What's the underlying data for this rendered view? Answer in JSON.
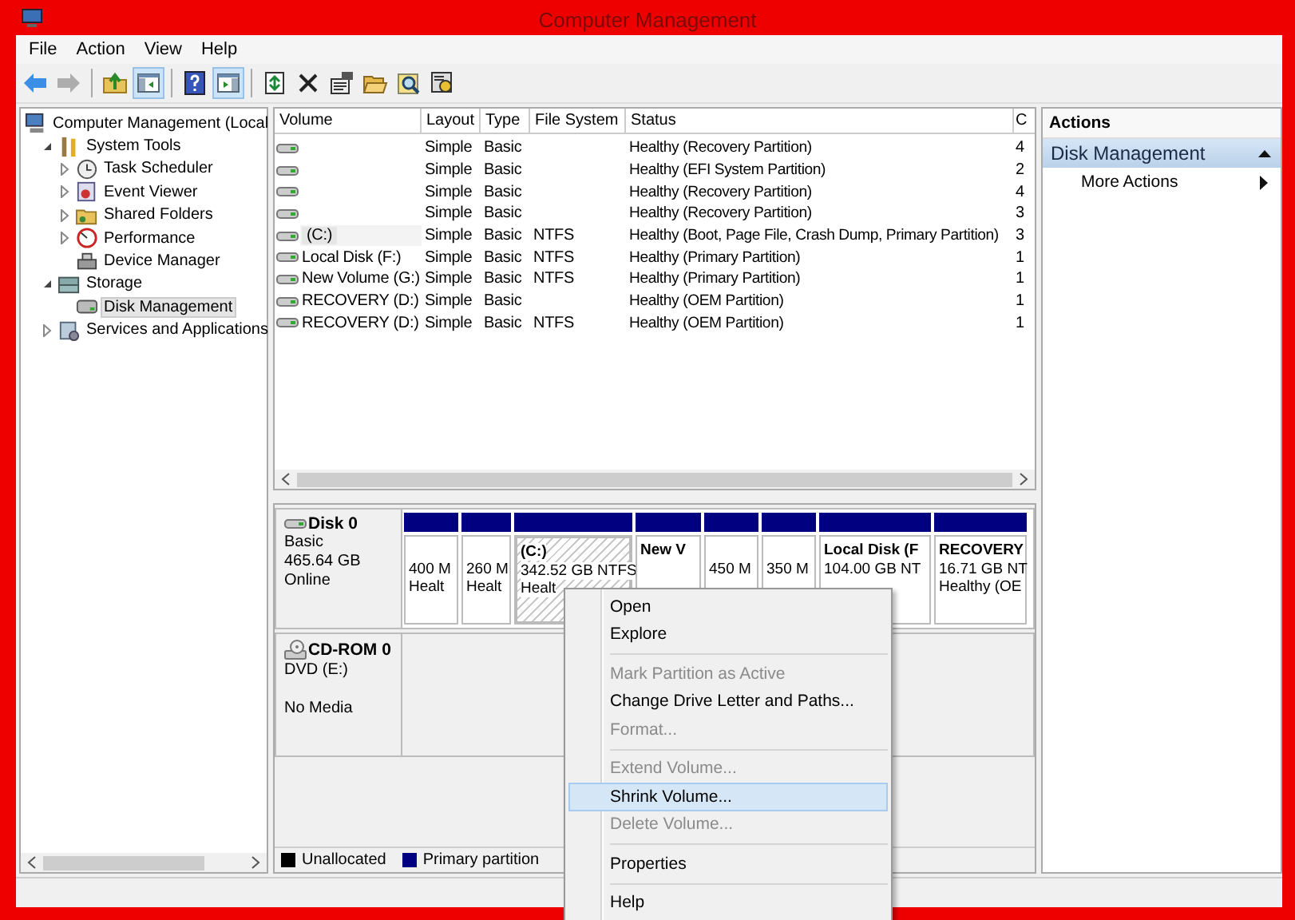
{
  "window": {
    "title": "Computer Management"
  },
  "menu_bar": [
    "File",
    "Action",
    "View",
    "Help"
  ],
  "toolbar": [
    {
      "kind": "button",
      "pressed": false,
      "disabled": false
    },
    {
      "kind": "button",
      "pressed": false,
      "disabled": true
    },
    {
      "kind": "separator"
    },
    {
      "kind": "button",
      "pressed": false,
      "disabled": false
    },
    {
      "kind": "button",
      "pressed": true,
      "disabled": false
    },
    {
      "kind": "separator"
    },
    {
      "kind": "button",
      "pressed": false,
      "disabled": false
    },
    {
      "kind": "button",
      "pressed": true,
      "disabled": false
    },
    {
      "kind": "separator"
    },
    {
      "kind": "button",
      "pressed": false,
      "disabled": false
    },
    {
      "kind": "button",
      "pressed": false,
      "disabled": false
    },
    {
      "kind": "button",
      "pressed": false,
      "disabled": false
    },
    {
      "kind": "button",
      "pressed": false,
      "disabled": false
    },
    {
      "kind": "button",
      "pressed": false,
      "disabled": false
    },
    {
      "kind": "button",
      "pressed": false,
      "disabled": false
    }
  ],
  "tree": [
    {
      "label": "Computer Management (Local",
      "selected": false,
      "children": [
        {
          "label": "System Tools",
          "expanded": true,
          "selected": false,
          "children": [
            {
              "label": "Task Scheduler",
              "expanded": false,
              "selected": false
            },
            {
              "label": "Event Viewer",
              "expanded": false,
              "selected": false
            },
            {
              "label": "Shared Folders",
              "expanded": false,
              "selected": false
            },
            {
              "label": "Performance",
              "expanded": false,
              "selected": false
            },
            {
              "label": "Device Manager",
              "selected": false
            }
          ]
        },
        {
          "label": "Storage",
          "expanded": true,
          "selected": false,
          "children": [
            {
              "label": "Disk Management",
              "selected": true
            }
          ]
        },
        {
          "label": "Services and Applications",
          "expanded": false,
          "selected": false
        }
      ]
    }
  ],
  "table": {
    "columns": [
      "Volume",
      "Layout",
      "Type",
      "File System",
      "Status",
      "C"
    ],
    "rows": [
      {
        "volume": "",
        "layout": "Simple",
        "type": "Basic",
        "file_system": "",
        "status": "Healthy (Recovery Partition)",
        "column_6": "4",
        "selected": false
      },
      {
        "volume": "",
        "layout": "Simple",
        "type": "Basic",
        "file_system": "",
        "status": "Healthy (EFI System Partition)",
        "column_6": "2",
        "selected": false
      },
      {
        "volume": "",
        "layout": "Simple",
        "type": "Basic",
        "file_system": "",
        "status": "Healthy (Recovery Partition)",
        "column_6": "4",
        "selected": false
      },
      {
        "volume": "",
        "layout": "Simple",
        "type": "Basic",
        "file_system": "",
        "status": "Healthy (Recovery Partition)",
        "column_6": "3",
        "selected": false
      },
      {
        "volume": "(C:)",
        "layout": "Simple",
        "type": "Basic",
        "file_system": "NTFS",
        "status": "Healthy (Boot, Page File, Crash Dump, Primary Partition)",
        "column_6": "3",
        "selected": true
      },
      {
        "volume": "Local Disk (F:)",
        "layout": "Simple",
        "type": "Basic",
        "file_system": "NTFS",
        "status": "Healthy (Primary Partition)",
        "column_6": "1",
        "selected": false
      },
      {
        "volume": "New Volume (G:)",
        "layout": "Simple",
        "type": "Basic",
        "file_system": "NTFS",
        "status": "Healthy (Primary Partition)",
        "column_6": "1",
        "selected": false
      },
      {
        "volume": "RECOVERY (D:)",
        "layout": "Simple",
        "type": "Basic",
        "file_system": "",
        "status": "Healthy (OEM Partition)",
        "column_6": "1",
        "selected": false
      },
      {
        "volume": "RECOVERY (D:)",
        "layout": "Simple",
        "type": "Basic",
        "file_system": "NTFS",
        "status": "Healthy (OEM Partition)",
        "column_6": "1",
        "selected": false
      }
    ]
  },
  "disks": [
    {
      "kind": "disk",
      "name": "Disk 0",
      "lines": [
        "Basic",
        "465.64 GB",
        "Online"
      ],
      "partitions": [
        {
          "details": [
            "400 M",
            "Healt"
          ],
          "selected": false
        },
        {
          "details": [
            "260 M",
            "Healt"
          ],
          "selected": false
        },
        {
          "label": "(C:)",
          "details": [
            "342.52 GB NTFS",
            "Healt"
          ],
          "selected": true
        },
        {
          "label": "New V",
          "selected": false
        },
        {
          "details": [
            "450 M"
          ],
          "selected": false
        },
        {
          "details": [
            "350 M"
          ],
          "selected": false
        },
        {
          "label": "Local Disk (F",
          "details": [
            "104.00 GB NT"
          ],
          "selected": false
        },
        {
          "label": "RECOVERY",
          "details": [
            "16.71 GB NT",
            "Healthy (OE"
          ],
          "selected": false
        }
      ]
    },
    {
      "kind": "cdrom",
      "name": "CD-ROM 0",
      "lines": [
        "DVD (E:)"
      ],
      "note": "No Media"
    }
  ],
  "legend": [
    {
      "label": "Unallocated",
      "color": "#000000"
    },
    {
      "label": "Primary partition",
      "color": "#000080"
    }
  ],
  "actions": {
    "title": "Actions",
    "section": {
      "label": "Disk Management",
      "expanded": true
    },
    "items": [
      "More Actions"
    ]
  },
  "context_menu": [
    {
      "kind": "item",
      "label": "Open",
      "disabled": false,
      "selected": false
    },
    {
      "kind": "item",
      "label": "Explore",
      "disabled": false,
      "selected": false
    },
    {
      "kind": "separator"
    },
    {
      "kind": "item",
      "label": "Mark Partition as Active",
      "disabled": true,
      "selected": false
    },
    {
      "kind": "item",
      "label": "Change Drive Letter and Paths...",
      "disabled": false,
      "selected": false
    },
    {
      "kind": "item",
      "label": "Format...",
      "disabled": true,
      "selected": false
    },
    {
      "kind": "separator"
    },
    {
      "kind": "item",
      "label": "Extend Volume...",
      "disabled": true,
      "selected": false
    },
    {
      "kind": "item",
      "label": "Shrink Volume...",
      "disabled": false,
      "selected": true
    },
    {
      "kind": "item",
      "label": "Delete Volume...",
      "disabled": true,
      "selected": false
    },
    {
      "kind": "separator"
    },
    {
      "kind": "item",
      "label": "Properties",
      "disabled": false,
      "selected": false
    },
    {
      "kind": "separator"
    },
    {
      "kind": "item",
      "label": "Help",
      "disabled": false,
      "selected": false
    }
  ]
}
